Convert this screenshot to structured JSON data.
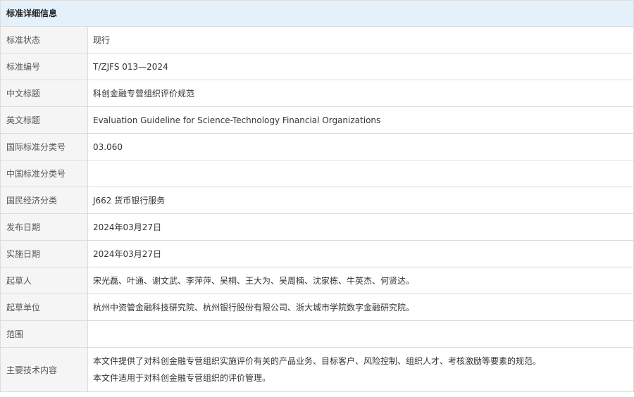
{
  "panel": {
    "title": "标准详细信息"
  },
  "rows": [
    {
      "label": "标准状态",
      "value": "现行"
    },
    {
      "label": "标准编号",
      "value": "T/ZJFS 013—2024"
    },
    {
      "label": "中文标题",
      "value": "科创金融专营组织评价规范"
    },
    {
      "label": "英文标题",
      "value": "Evaluation Guideline for Science-Technology Financial Organizations"
    },
    {
      "label": "国际标准分类号",
      "value": "03.060"
    },
    {
      "label": "中国标准分类号",
      "value": ""
    },
    {
      "label": "国民经济分类",
      "value": "J662 货币银行服务"
    },
    {
      "label": "发布日期",
      "value": "2024年03月27日"
    },
    {
      "label": "实施日期",
      "value": "2024年03月27日"
    },
    {
      "label": "起草人",
      "value": "宋光磊、叶通、谢文武、李萍萍、吴桐、王大为、吴周楠、沈家栋、牛英杰、何贤达。"
    },
    {
      "label": "起草单位",
      "value": "杭州中资管金融科技研究院、杭州银行股份有限公司、浙大城市学院数字金融研究院。"
    },
    {
      "label": "范围",
      "value": ""
    }
  ],
  "main_content": {
    "label": "主要技术内容",
    "line1": "本文件提供了对科创金融专营组织实施评价有关的产品业务、目标客户、风险控制、组织人才、考核激励等要素的规范。",
    "line2": "本文件适用于对科创金融专营组织的评价管理。"
  }
}
